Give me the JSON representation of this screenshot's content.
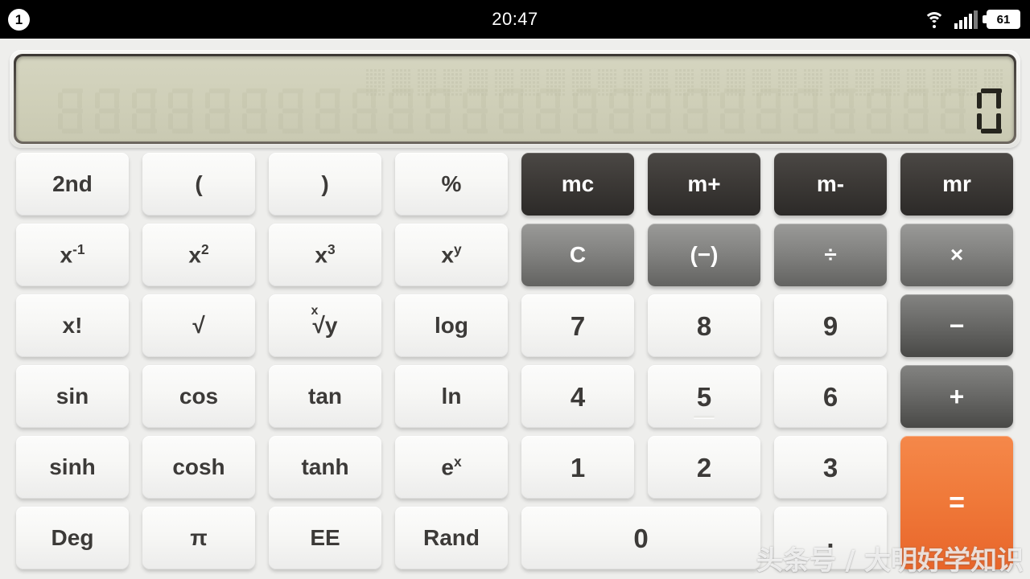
{
  "statusbar": {
    "notification_badge": "1",
    "time": "20:47",
    "battery_level": "61",
    "wifi_icon": "wifi-icon",
    "signal_icon": "signal-bars-icon",
    "battery_icon": "battery-icon"
  },
  "display": {
    "value": "0",
    "ghost_digit_count": 26,
    "ghost_matrix_count": 25,
    "lcd_color": "#cfcfb8",
    "bezel_color": "#4a4540"
  },
  "keypad": {
    "rows": [
      [
        {
          "label": "2nd",
          "name": "key-2nd",
          "style": "light"
        },
        {
          "label": "(",
          "name": "key-open-paren",
          "style": "light"
        },
        {
          "label": ")",
          "name": "key-close-paren",
          "style": "light"
        },
        {
          "label": "%",
          "name": "key-percent",
          "style": "light"
        },
        {
          "label": "mc",
          "name": "key-mc",
          "style": "dark"
        },
        {
          "label": "m+",
          "name": "key-m-plus",
          "style": "dark"
        },
        {
          "label": "m-",
          "name": "key-m-minus",
          "style": "dark"
        },
        {
          "label": "mr",
          "name": "key-mr",
          "style": "dark"
        }
      ],
      [
        {
          "label": "x-1",
          "name": "key-reciprocal",
          "style": "light",
          "sup": "-1",
          "base": "x"
        },
        {
          "label": "x2",
          "name": "key-square",
          "style": "light",
          "sup": "2",
          "base": "x"
        },
        {
          "label": "x3",
          "name": "key-cube",
          "style": "light",
          "sup": "3",
          "base": "x"
        },
        {
          "label": "xy",
          "name": "key-power",
          "style": "light",
          "sup": "y",
          "base": "x"
        },
        {
          "label": "C",
          "name": "key-clear",
          "style": "grey"
        },
        {
          "label": "(−)",
          "name": "key-negate",
          "style": "grey"
        },
        {
          "label": "÷",
          "name": "key-divide",
          "style": "grey"
        },
        {
          "label": "×",
          "name": "key-multiply",
          "style": "grey"
        }
      ],
      [
        {
          "label": "x!",
          "name": "key-factorial",
          "style": "light"
        },
        {
          "label": "√",
          "name": "key-sqrt",
          "style": "light"
        },
        {
          "label": "x√y",
          "name": "key-nth-root",
          "style": "light",
          "root": true
        },
        {
          "label": "log",
          "name": "key-log",
          "style": "light"
        },
        {
          "label": "7",
          "name": "key-7",
          "style": "light",
          "digit": true
        },
        {
          "label": "8",
          "name": "key-8",
          "style": "light",
          "digit": true
        },
        {
          "label": "9",
          "name": "key-9",
          "style": "light",
          "digit": true
        },
        {
          "label": "−",
          "name": "key-subtract",
          "style": "grey-dark"
        }
      ],
      [
        {
          "label": "sin",
          "name": "key-sin",
          "style": "light"
        },
        {
          "label": "cos",
          "name": "key-cos",
          "style": "light"
        },
        {
          "label": "tan",
          "name": "key-tan",
          "style": "light"
        },
        {
          "label": "ln",
          "name": "key-ln",
          "style": "light"
        },
        {
          "label": "4",
          "name": "key-4",
          "style": "light",
          "digit": true
        },
        {
          "label": "5",
          "name": "key-5",
          "style": "light",
          "digit": true,
          "homebar": true
        },
        {
          "label": "6",
          "name": "key-6",
          "style": "light",
          "digit": true
        },
        {
          "label": "+",
          "name": "key-add",
          "style": "grey-dark"
        }
      ],
      [
        {
          "label": "sinh",
          "name": "key-sinh",
          "style": "light"
        },
        {
          "label": "cosh",
          "name": "key-cosh",
          "style": "light"
        },
        {
          "label": "tanh",
          "name": "key-tanh",
          "style": "light"
        },
        {
          "label": "ex",
          "name": "key-exp",
          "style": "light",
          "sup": "x",
          "base": "e"
        },
        {
          "label": "1",
          "name": "key-1",
          "style": "light",
          "digit": true
        },
        {
          "label": "2",
          "name": "key-2",
          "style": "light",
          "digit": true
        },
        {
          "label": "3",
          "name": "key-3",
          "style": "light",
          "digit": true
        },
        {
          "label": "=",
          "name": "key-equals",
          "style": "orange",
          "tall": true
        }
      ],
      [
        {
          "label": "Deg",
          "name": "key-deg",
          "style": "light"
        },
        {
          "label": "π",
          "name": "key-pi",
          "style": "light"
        },
        {
          "label": "EE",
          "name": "key-ee",
          "style": "light"
        },
        {
          "label": "Rand",
          "name": "key-rand",
          "style": "light"
        },
        {
          "label": "0",
          "name": "key-0",
          "style": "light",
          "digit": true,
          "wide": true
        },
        {
          "label": ".",
          "name": "key-decimal",
          "style": "light",
          "digit": true
        }
      ]
    ]
  },
  "watermark": {
    "text": "头条号 / 大明好学知识"
  },
  "colors": {
    "background": "#eeeeec",
    "accent_orange": "#ef7834",
    "key_light": "#f7f7f5",
    "key_dark": "#3c3936",
    "key_grey": "#838381",
    "lcd": "#cfcfb8"
  }
}
